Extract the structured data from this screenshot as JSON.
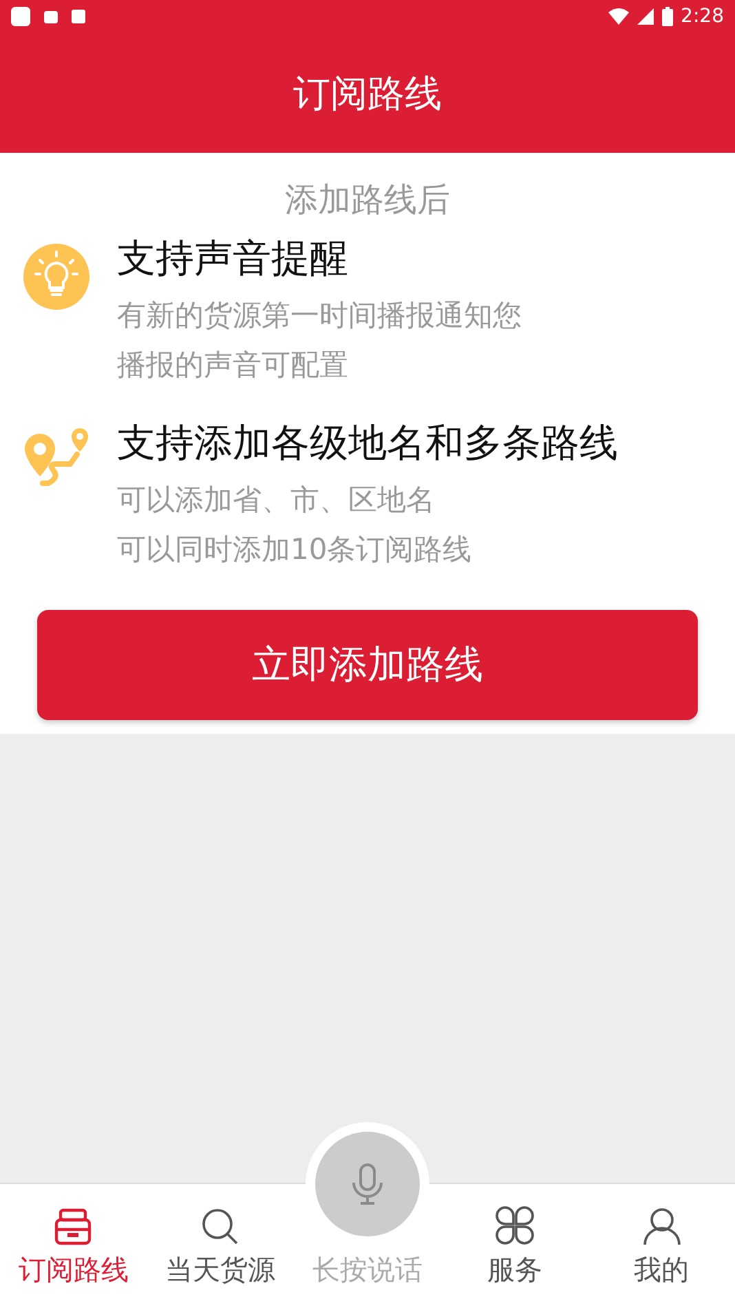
{
  "status_bar": {
    "time": "2:28"
  },
  "header": {
    "title": "订阅路线"
  },
  "intro": "添加路线后",
  "features": [
    {
      "kind": "bulb",
      "title": "支持声音提醒",
      "lines": [
        "有新的货源第一时间播报通知您",
        "播报的声音可配置"
      ]
    },
    {
      "kind": "route",
      "title": "支持添加各级地名和多条路线",
      "lines": [
        "可以添加省、市、区地名",
        "可以同时添加10条订阅路线"
      ]
    }
  ],
  "action_button": "立即添加路线",
  "tabs": [
    {
      "kind": "subscribe",
      "label": "订阅路线",
      "selected": true
    },
    {
      "kind": "search",
      "label": "当天货源",
      "selected": false
    },
    {
      "kind": "voice",
      "label": "长按说话",
      "selected": false
    },
    {
      "kind": "services",
      "label": "服务",
      "selected": false
    },
    {
      "kind": "profile",
      "label": "我的",
      "selected": false
    }
  ]
}
